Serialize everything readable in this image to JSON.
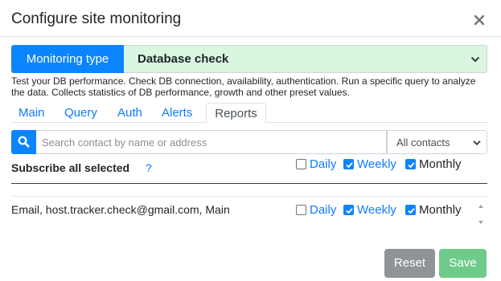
{
  "dialog": {
    "title": "Configure site monitoring"
  },
  "monitoring": {
    "type_label": "Monitoring type",
    "type_value": "Database check",
    "description": "Test your DB performance. Check DB connection, availability, authentication. Run a specific query to analyze the data. Collects statistics of DB performance, growth and other preset values."
  },
  "tabs": [
    {
      "label": "Main",
      "active": false
    },
    {
      "label": "Query",
      "active": false
    },
    {
      "label": "Auth",
      "active": false
    },
    {
      "label": "Alerts",
      "active": false
    },
    {
      "label": "Reports",
      "active": true
    }
  ],
  "search": {
    "placeholder": "Search contact by name or address",
    "filter_value": "All contacts"
  },
  "subscribe_all": {
    "label": "Subscribe all selected",
    "help": "?",
    "daily": {
      "label": "Daily",
      "checked": false
    },
    "weekly": {
      "label": "Weekly",
      "checked": true
    },
    "monthly": {
      "label": "Monthly",
      "checked": true
    }
  },
  "contacts": [
    {
      "text": "Email, host.tracker.check@gmail.com, Main",
      "daily": {
        "label": "Daily",
        "checked": false
      },
      "weekly": {
        "label": "Weekly",
        "checked": true
      },
      "monthly": {
        "label": "Monthly",
        "checked": true
      }
    }
  ],
  "footer": {
    "reset_label": "Reset",
    "save_label": "Save"
  },
  "colors": {
    "accent": "#0d84ff",
    "link": "#0d7cff",
    "select_bg": "#d9f6e1",
    "reset_bg": "#8f9499",
    "save_bg": "#6fcb89"
  },
  "icons": {
    "close": "close-icon",
    "search": "search-icon",
    "caret": "chevron-down-icon",
    "check": "check-icon"
  }
}
